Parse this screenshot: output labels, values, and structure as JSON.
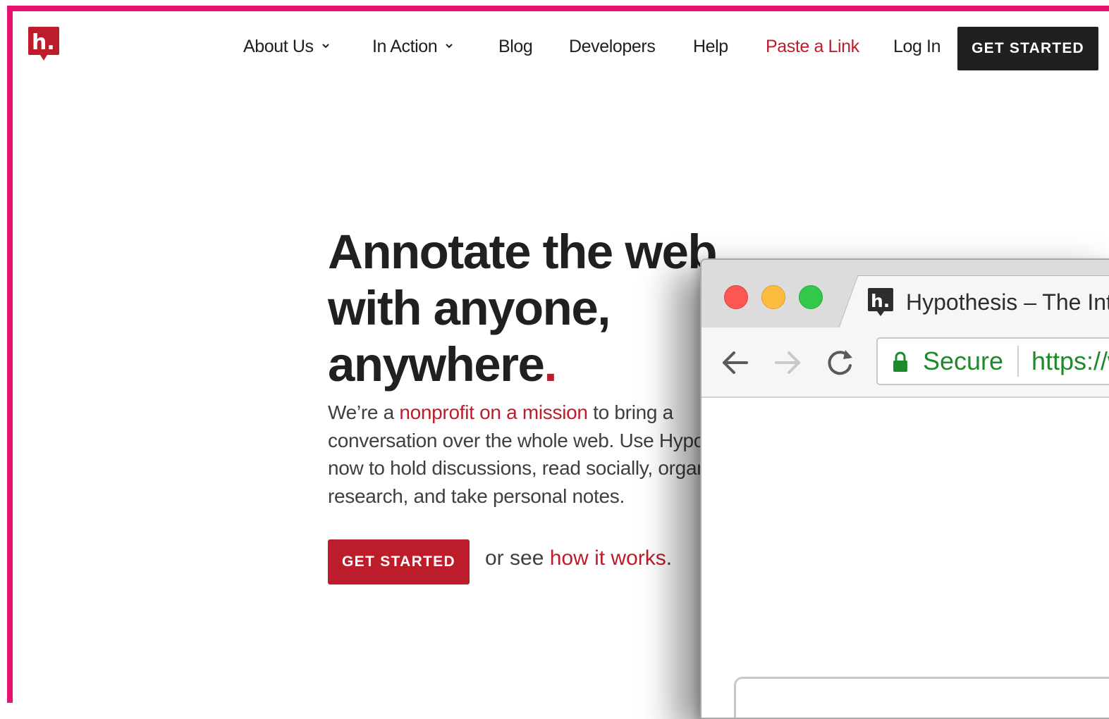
{
  "colors": {
    "accent": "#bd1c2b",
    "frame": "#e5136d",
    "dark": "#202020"
  },
  "header": {
    "logo_letter": "h.",
    "nav": {
      "about_us": "About Us",
      "in_action": "In Action",
      "blog": "Blog",
      "developers": "Developers",
      "help": "Help",
      "paste_link": "Paste a Link",
      "log_in": "Log In"
    },
    "cta": "GET STARTED"
  },
  "hero": {
    "title_line1": "Annotate the web",
    "title_line2": "with anyone,",
    "title_line3": "anywhere",
    "title_dot": ".",
    "text_pre": "We’re a ",
    "text_link": "nonprofit on a mission",
    "text_line1_rest": " to bring a",
    "text_line2": "conversation over the whole web. Use Hypothesis",
    "text_line3": "now to hold discussions, read socially, organize",
    "text_line4": "research, and take personal notes.",
    "cta": "GET STARTED",
    "see_pre": "or see ",
    "see_link": "how it works",
    "see_post": "."
  },
  "browser": {
    "tab_title": "Hypothesis – The Internet, peer reviewed.",
    "secure_label": "Secure",
    "url": "https://web.hypothes.is",
    "icons": [
      "close-light",
      "minimize-light",
      "zoom-light",
      "back-arrow-icon",
      "forward-arrow-icon",
      "reload-icon",
      "lock-icon",
      "favicon-icon"
    ]
  }
}
